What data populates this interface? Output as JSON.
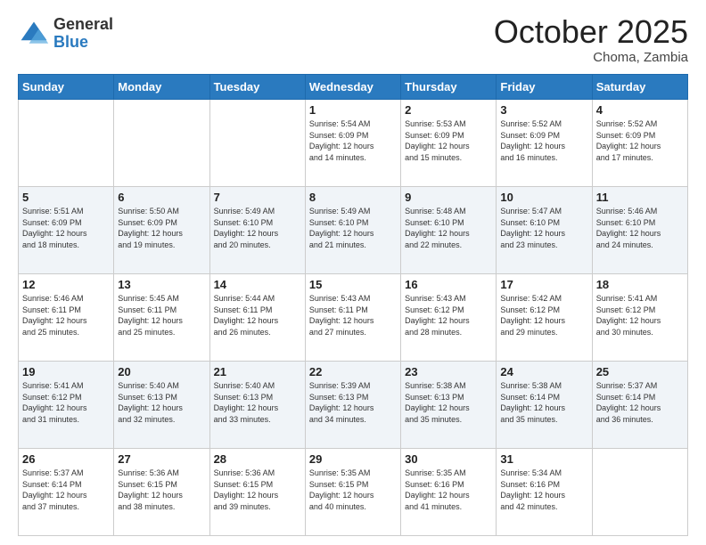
{
  "logo": {
    "general": "General",
    "blue": "Blue"
  },
  "title": "October 2025",
  "location": "Choma, Zambia",
  "days_of_week": [
    "Sunday",
    "Monday",
    "Tuesday",
    "Wednesday",
    "Thursday",
    "Friday",
    "Saturday"
  ],
  "weeks": [
    [
      {
        "day": "",
        "info": ""
      },
      {
        "day": "",
        "info": ""
      },
      {
        "day": "",
        "info": ""
      },
      {
        "day": "1",
        "info": "Sunrise: 5:54 AM\nSunset: 6:09 PM\nDaylight: 12 hours\nand 14 minutes."
      },
      {
        "day": "2",
        "info": "Sunrise: 5:53 AM\nSunset: 6:09 PM\nDaylight: 12 hours\nand 15 minutes."
      },
      {
        "day": "3",
        "info": "Sunrise: 5:52 AM\nSunset: 6:09 PM\nDaylight: 12 hours\nand 16 minutes."
      },
      {
        "day": "4",
        "info": "Sunrise: 5:52 AM\nSunset: 6:09 PM\nDaylight: 12 hours\nand 17 minutes."
      }
    ],
    [
      {
        "day": "5",
        "info": "Sunrise: 5:51 AM\nSunset: 6:09 PM\nDaylight: 12 hours\nand 18 minutes."
      },
      {
        "day": "6",
        "info": "Sunrise: 5:50 AM\nSunset: 6:09 PM\nDaylight: 12 hours\nand 19 minutes."
      },
      {
        "day": "7",
        "info": "Sunrise: 5:49 AM\nSunset: 6:10 PM\nDaylight: 12 hours\nand 20 minutes."
      },
      {
        "day": "8",
        "info": "Sunrise: 5:49 AM\nSunset: 6:10 PM\nDaylight: 12 hours\nand 21 minutes."
      },
      {
        "day": "9",
        "info": "Sunrise: 5:48 AM\nSunset: 6:10 PM\nDaylight: 12 hours\nand 22 minutes."
      },
      {
        "day": "10",
        "info": "Sunrise: 5:47 AM\nSunset: 6:10 PM\nDaylight: 12 hours\nand 23 minutes."
      },
      {
        "day": "11",
        "info": "Sunrise: 5:46 AM\nSunset: 6:10 PM\nDaylight: 12 hours\nand 24 minutes."
      }
    ],
    [
      {
        "day": "12",
        "info": "Sunrise: 5:46 AM\nSunset: 6:11 PM\nDaylight: 12 hours\nand 25 minutes."
      },
      {
        "day": "13",
        "info": "Sunrise: 5:45 AM\nSunset: 6:11 PM\nDaylight: 12 hours\nand 25 minutes."
      },
      {
        "day": "14",
        "info": "Sunrise: 5:44 AM\nSunset: 6:11 PM\nDaylight: 12 hours\nand 26 minutes."
      },
      {
        "day": "15",
        "info": "Sunrise: 5:43 AM\nSunset: 6:11 PM\nDaylight: 12 hours\nand 27 minutes."
      },
      {
        "day": "16",
        "info": "Sunrise: 5:43 AM\nSunset: 6:12 PM\nDaylight: 12 hours\nand 28 minutes."
      },
      {
        "day": "17",
        "info": "Sunrise: 5:42 AM\nSunset: 6:12 PM\nDaylight: 12 hours\nand 29 minutes."
      },
      {
        "day": "18",
        "info": "Sunrise: 5:41 AM\nSunset: 6:12 PM\nDaylight: 12 hours\nand 30 minutes."
      }
    ],
    [
      {
        "day": "19",
        "info": "Sunrise: 5:41 AM\nSunset: 6:12 PM\nDaylight: 12 hours\nand 31 minutes."
      },
      {
        "day": "20",
        "info": "Sunrise: 5:40 AM\nSunset: 6:13 PM\nDaylight: 12 hours\nand 32 minutes."
      },
      {
        "day": "21",
        "info": "Sunrise: 5:40 AM\nSunset: 6:13 PM\nDaylight: 12 hours\nand 33 minutes."
      },
      {
        "day": "22",
        "info": "Sunrise: 5:39 AM\nSunset: 6:13 PM\nDaylight: 12 hours\nand 34 minutes."
      },
      {
        "day": "23",
        "info": "Sunrise: 5:38 AM\nSunset: 6:13 PM\nDaylight: 12 hours\nand 35 minutes."
      },
      {
        "day": "24",
        "info": "Sunrise: 5:38 AM\nSunset: 6:14 PM\nDaylight: 12 hours\nand 35 minutes."
      },
      {
        "day": "25",
        "info": "Sunrise: 5:37 AM\nSunset: 6:14 PM\nDaylight: 12 hours\nand 36 minutes."
      }
    ],
    [
      {
        "day": "26",
        "info": "Sunrise: 5:37 AM\nSunset: 6:14 PM\nDaylight: 12 hours\nand 37 minutes."
      },
      {
        "day": "27",
        "info": "Sunrise: 5:36 AM\nSunset: 6:15 PM\nDaylight: 12 hours\nand 38 minutes."
      },
      {
        "day": "28",
        "info": "Sunrise: 5:36 AM\nSunset: 6:15 PM\nDaylight: 12 hours\nand 39 minutes."
      },
      {
        "day": "29",
        "info": "Sunrise: 5:35 AM\nSunset: 6:15 PM\nDaylight: 12 hours\nand 40 minutes."
      },
      {
        "day": "30",
        "info": "Sunrise: 5:35 AM\nSunset: 6:16 PM\nDaylight: 12 hours\nand 41 minutes."
      },
      {
        "day": "31",
        "info": "Sunrise: 5:34 AM\nSunset: 6:16 PM\nDaylight: 12 hours\nand 42 minutes."
      },
      {
        "day": "",
        "info": ""
      }
    ]
  ]
}
